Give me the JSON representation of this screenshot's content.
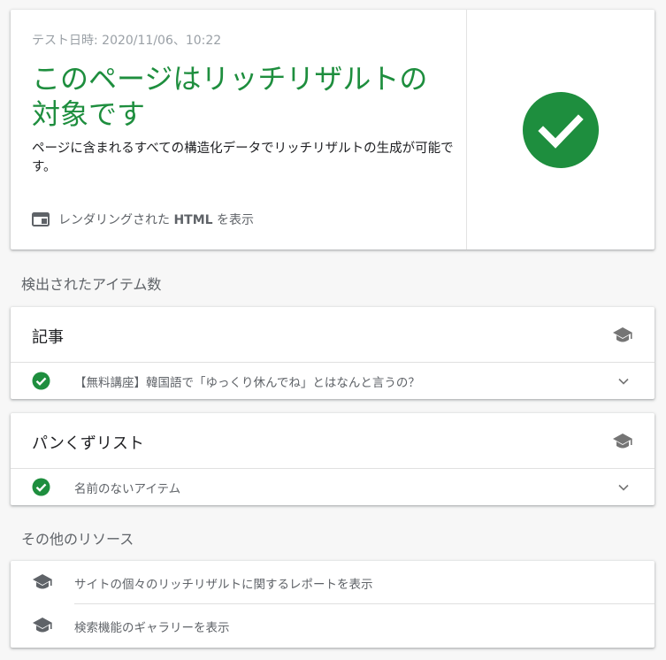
{
  "result": {
    "test_date": "テスト日時: 2020/11/06、10:22",
    "title": "このページはリッチリザルトの対象です",
    "description": "ページに含まれるすべての構造化データでリッチリザルトの生成が可能です。",
    "view_html_prefix": "レンダリングされた",
    "view_html_strong": "HTML",
    "view_html_suffix": "を表示",
    "status_color": "#1e8e3e"
  },
  "detected": {
    "header": "検出されたアイテム数",
    "items": [
      {
        "title": "記事",
        "entry": "【無料講座】韓国語で「ゆっくり休んでね」とはなんと言うの？"
      },
      {
        "title": "パンくずリスト",
        "entry": "名前のないアイテム"
      }
    ]
  },
  "other": {
    "header": "その他のリソース",
    "links": [
      {
        "label": "サイトの個々のリッチリザルトに関するレポートを表示",
        "icon": "graduation-cap-icon"
      },
      {
        "label": "検索機能のギャラリーを表示",
        "icon": "graduation-cap-icon"
      }
    ]
  },
  "colors": {
    "success": "#1e8e3e",
    "secondary_text": "#5f6368",
    "icon_gray": "#757575"
  }
}
